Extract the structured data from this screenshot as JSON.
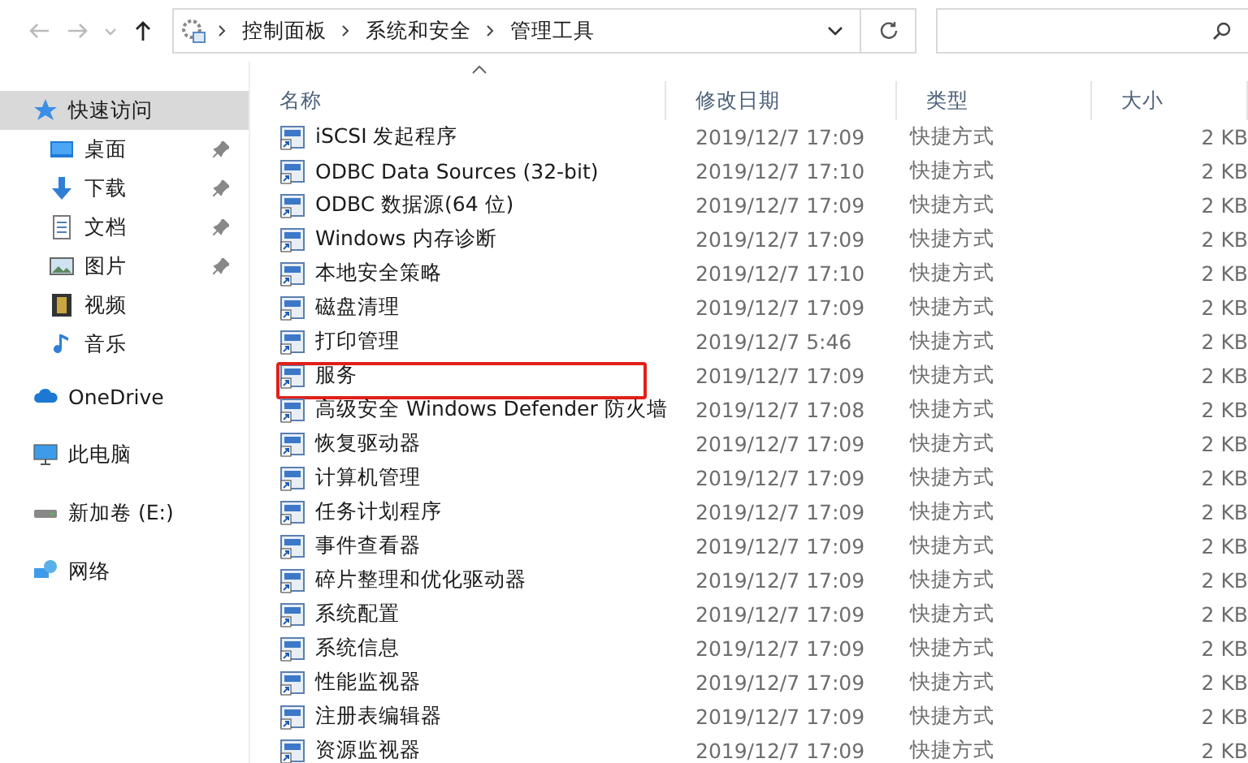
{
  "toolbar": {
    "buttons": [
      {
        "kind": "back",
        "disabled": true
      },
      {
        "kind": "forward",
        "disabled": true
      },
      {
        "kind": "history",
        "disabled": true
      },
      {
        "kind": "up",
        "disabled": false
      }
    ],
    "breadcrumbs": [
      "控制面板",
      "系统和安全",
      "管理工具"
    ]
  },
  "sidebar": {
    "items": [
      {
        "label": "快速访问",
        "kind": "star",
        "selected": true,
        "children": [
          {
            "label": "桌面",
            "kind": "desktop",
            "pinned": true,
            "selected": false
          },
          {
            "label": "下载",
            "kind": "download",
            "pinned": true,
            "selected": false
          },
          {
            "label": "文档",
            "kind": "document",
            "pinned": true,
            "selected": false
          },
          {
            "label": "图片",
            "kind": "picture",
            "pinned": true,
            "selected": false
          },
          {
            "label": "视频",
            "kind": "video",
            "pinned": false,
            "selected": false
          },
          {
            "label": "音乐",
            "kind": "music",
            "pinned": false,
            "selected": false
          }
        ]
      },
      {
        "label": "OneDrive",
        "kind": "cloud",
        "selected": false
      },
      {
        "label": "此电脑",
        "kind": "computer",
        "selected": false
      },
      {
        "label": "新加卷 (E:)",
        "kind": "drive",
        "selected": false
      },
      {
        "label": "网络",
        "kind": "network",
        "selected": false
      }
    ]
  },
  "table": {
    "columns": [
      {
        "label": "名称",
        "sorted": true
      },
      {
        "label": "修改日期",
        "sorted": false
      },
      {
        "label": "类型",
        "sorted": false
      },
      {
        "label": "大小",
        "sorted": false
      }
    ],
    "rows": [
      {
        "name": "iSCSI 发起程序",
        "date": "2019/12/7 17:09",
        "type": "快捷方式",
        "size": "2 KB",
        "outlined": false
      },
      {
        "name": "ODBC Data Sources (32-bit)",
        "date": "2019/12/7 17:10",
        "type": "快捷方式",
        "size": "2 KB",
        "outlined": false
      },
      {
        "name": "ODBC 数据源(64 位)",
        "date": "2019/12/7 17:09",
        "type": "快捷方式",
        "size": "2 KB",
        "outlined": false
      },
      {
        "name": "Windows 内存诊断",
        "date": "2019/12/7 17:09",
        "type": "快捷方式",
        "size": "2 KB",
        "outlined": false
      },
      {
        "name": "本地安全策略",
        "date": "2019/12/7 17:10",
        "type": "快捷方式",
        "size": "2 KB",
        "outlined": false
      },
      {
        "name": "磁盘清理",
        "date": "2019/12/7 17:09",
        "type": "快捷方式",
        "size": "2 KB",
        "outlined": false
      },
      {
        "name": "打印管理",
        "date": "2019/12/7 5:46",
        "type": "快捷方式",
        "size": "2 KB",
        "outlined": false
      },
      {
        "name": "服务",
        "date": "2019/12/7 17:09",
        "type": "快捷方式",
        "size": "2 KB",
        "outlined": true
      },
      {
        "name": "高级安全 Windows Defender 防火墙",
        "date": "2019/12/7 17:08",
        "type": "快捷方式",
        "size": "2 KB",
        "outlined": false
      },
      {
        "name": "恢复驱动器",
        "date": "2019/12/7 17:09",
        "type": "快捷方式",
        "size": "2 KB",
        "outlined": false
      },
      {
        "name": "计算机管理",
        "date": "2019/12/7 17:09",
        "type": "快捷方式",
        "size": "2 KB",
        "outlined": false
      },
      {
        "name": "任务计划程序",
        "date": "2019/12/7 17:09",
        "type": "快捷方式",
        "size": "2 KB",
        "outlined": false
      },
      {
        "name": "事件查看器",
        "date": "2019/12/7 17:09",
        "type": "快捷方式",
        "size": "2 KB",
        "outlined": false
      },
      {
        "name": "碎片整理和优化驱动器",
        "date": "2019/12/7 17:09",
        "type": "快捷方式",
        "size": "2 KB",
        "outlined": false
      },
      {
        "name": "系统配置",
        "date": "2019/12/7 17:09",
        "type": "快捷方式",
        "size": "2 KB",
        "outlined": false
      },
      {
        "name": "系统信息",
        "date": "2019/12/7 17:09",
        "type": "快捷方式",
        "size": "2 KB",
        "outlined": false
      },
      {
        "name": "性能监视器",
        "date": "2019/12/7 17:09",
        "type": "快捷方式",
        "size": "2 KB",
        "outlined": false
      },
      {
        "name": "注册表编辑器",
        "date": "2019/12/7 17:09",
        "type": "快捷方式",
        "size": "2 KB",
        "outlined": false
      },
      {
        "name": "资源监视器",
        "date": "2019/12/7 17:09",
        "type": "快捷方式",
        "size": "2 KB",
        "outlined": false
      }
    ]
  }
}
